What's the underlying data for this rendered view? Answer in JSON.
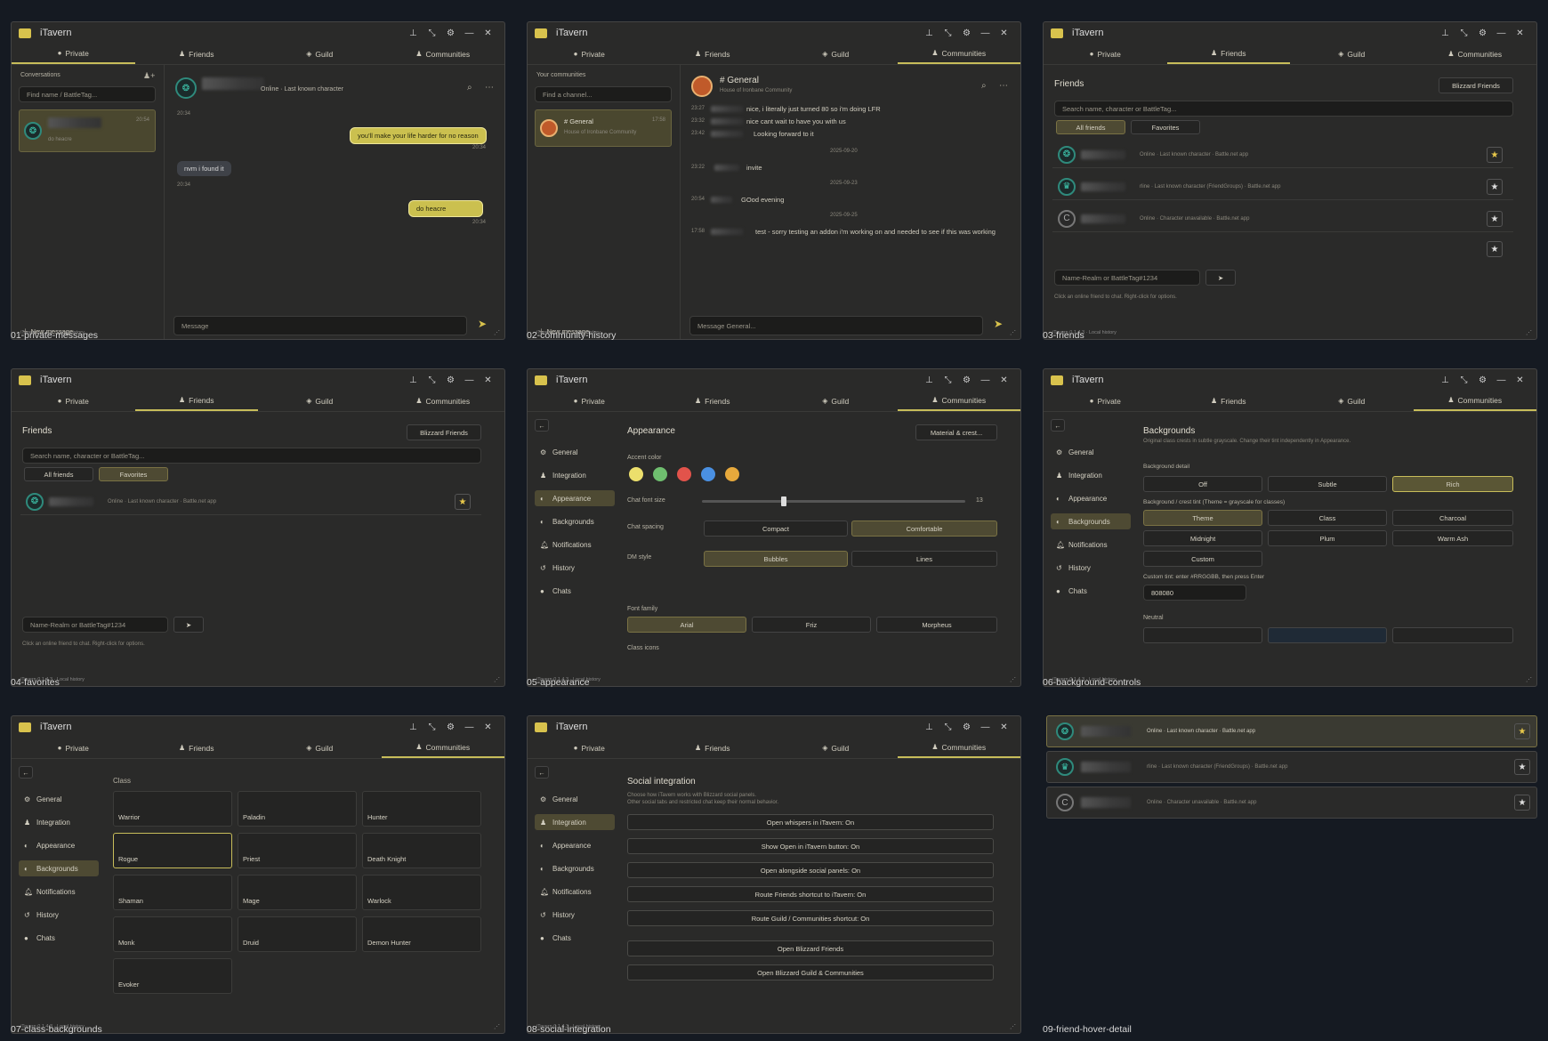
{
  "app": {
    "title": "iTavern",
    "tabs": [
      "Private",
      "Friends",
      "Guild",
      "Communities"
    ],
    "footer": "iTavern 0.1.4.3  ·  Local history",
    "controls": {
      "pin": "⊥",
      "compact": "⤡",
      "settings": "⚙",
      "minimize": "—",
      "close": "✕"
    }
  },
  "captions": [
    "01-private-messages",
    "02-community-history",
    "03-friends",
    "04-favorites",
    "05-appearance",
    "06-background-controls",
    "07-class-backgrounds",
    "08-social-integration",
    "09-friend-hover-detail"
  ],
  "p1": {
    "conversations": "Conversations",
    "search_ph": "Find name / BattleTag...",
    "conv_time": "20:54",
    "conv_preview": "do heacre",
    "status": "Online · Last known character",
    "msgs": [
      {
        "t": "20:34"
      },
      {
        "text": "you'll make your life harder for no reason",
        "t": "20:34"
      },
      {
        "text": "nvm i found it",
        "t": "20:34"
      },
      {
        "text": "do heacre",
        "t": "20:34"
      }
    ],
    "new_message": "New message",
    "input_ph": "Message"
  },
  "p2": {
    "your_communities": "Your communities",
    "find_ph": "Find a channel...",
    "ch_name": "# General",
    "ch_sub": "House of Ironbane Community",
    "ch_time": "17:58",
    "head_title": "# General",
    "head_sub": "House of Ironbane Community",
    "lines": [
      {
        "t": "23:27",
        "text": "nice, i literally just turned 80 so i'm doing LFR"
      },
      {
        "t": "23:32",
        "text": "nice cant wait to have you with us"
      },
      {
        "t": "23:42",
        "text": "Looking forward to it"
      },
      {
        "d": "2025-09-20"
      },
      {
        "t": "23:22",
        "text": "invite"
      },
      {
        "d": "2025-09-23"
      },
      {
        "t": "20:54",
        "text": "GOod evening"
      },
      {
        "d": "2025-09-25"
      },
      {
        "t": "17:58",
        "text": "test - sorry testing an addon i'm working on and needed to see if this was working"
      }
    ],
    "new_message": "New message",
    "input_ph": "Message General..."
  },
  "p3": {
    "title": "Friends",
    "bnet": "Blizzard Friends",
    "search_ph": "Search name, character or BattleTag...",
    "all": "All friends",
    "fav": "Favorites",
    "rows": [
      "Online · Last known character · Battle.net app",
      "rline · Last known character (FriendGroups) · Battle.net app",
      "Online · Character unavailable · Battle.net app"
    ],
    "add_ph": "Name-Realm or BattleTag#1234",
    "hint": "Click an online friend to chat. Right-click for options."
  },
  "p4": {
    "title": "Friends",
    "bnet": "Blizzard Friends",
    "search_ph": "Search name, character or BattleTag...",
    "all": "All friends",
    "fav": "Favorites",
    "row": "Online · Last known character · Battle.net app",
    "add_ph": "Name-Realm or BattleTag#1234",
    "hint": "Click an online friend to chat. Right-click for options."
  },
  "nav": [
    "General",
    "Integration",
    "Appearance",
    "Backgrounds",
    "Notifications",
    "History",
    "Chats"
  ],
  "p5": {
    "title": "Appearance",
    "material": "Material & crest...",
    "accent": "Accent color",
    "accent_colors": [
      "#ecdf6c",
      "#6fbf6f",
      "#e2534b",
      "#4a90e2",
      "#e7a93c"
    ],
    "font_size": "Chat font size",
    "font_val": "13",
    "font_level": 0.3,
    "spacing": "Chat spacing",
    "compact": "Compact",
    "comfortable": "Comfortable",
    "dm": "DM style",
    "bubbles": "Bubbles",
    "lines": "Lines",
    "family": "Font family",
    "arial": "Arial",
    "friz": "Friz",
    "morpheus": "Morpheus",
    "icons": "Class icons"
  },
  "p6": {
    "title": "Backgrounds",
    "sub": "Original class crests in subtle grayscale. Change their tint independently in Appearance.",
    "detail": "Background detail",
    "off": "Off",
    "subtle": "Subtle",
    "rich": "Rich",
    "tint": "Background / crest tint (Theme = grayscale for classes)",
    "tints": [
      "Theme",
      "Class",
      "Charcoal",
      "Midnight",
      "Plum",
      "Warm Ash",
      "Custom"
    ],
    "custom_lbl": "Custom tint: enter #RRGGBB, then press Enter",
    "custom_val": "808080",
    "neutral": "Neutral"
  },
  "p7": {
    "class": "Class",
    "classes": [
      "Warrior",
      "Paladin",
      "Hunter",
      "Rogue",
      "Priest",
      "Death Knight",
      "Shaman",
      "Mage",
      "Warlock",
      "Monk",
      "Druid",
      "Demon Hunter",
      "Evoker"
    ]
  },
  "p8": {
    "title": "Social integration",
    "desc1": "Choose how iTavern works with Blizzard social panels.",
    "desc2": "Other social tabs and restricted chat keep their normal behavior.",
    "opts": [
      "Open whispers in iTavern: On",
      "Show Open in iTavern button: On",
      "Open alongside social panels: On",
      "Route Friends shortcut to iTavern: On",
      "Route Guild / Communities shortcut: On"
    ],
    "bnet_friends": "Open Blizzard Friends",
    "bnet_guild": "Open Blizzard Guild & Communities"
  },
  "p9": {
    "rows": [
      "Online · Last known character · Battle.net app",
      "rline · Last known character (FriendGroups) · Battle.net app",
      "Online · Character unavailable · Battle.net app"
    ]
  }
}
